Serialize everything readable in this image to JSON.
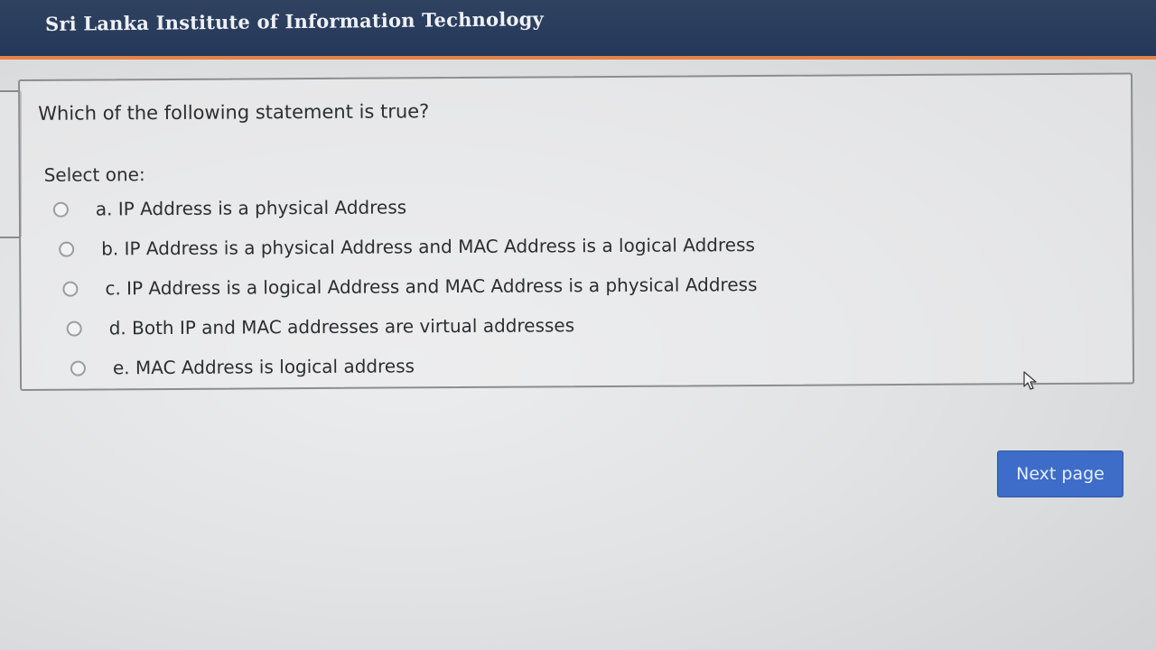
{
  "header": {
    "title": "Sri Lanka Institute of Information Technology"
  },
  "question": {
    "prompt": "Which of the following statement is true?",
    "select_label": "Select one:",
    "options": [
      {
        "label": "a. IP Address is a physical Address"
      },
      {
        "label": "b. IP Address is a physical Address and MAC Address is a logical Address"
      },
      {
        "label": "c. IP Address is a logical Address and MAC Address is a physical Address"
      },
      {
        "label": "d. Both IP and MAC addresses are virtual addresses"
      },
      {
        "label": "e. MAC Address is logical address"
      }
    ]
  },
  "navigation": {
    "next_label": "Next page"
  },
  "colors": {
    "header_bg": "#26385a",
    "header_accent": "#e4834b",
    "button_bg": "#3d6cc9"
  },
  "icons": {
    "cursor": "mouse-pointer-icon"
  }
}
